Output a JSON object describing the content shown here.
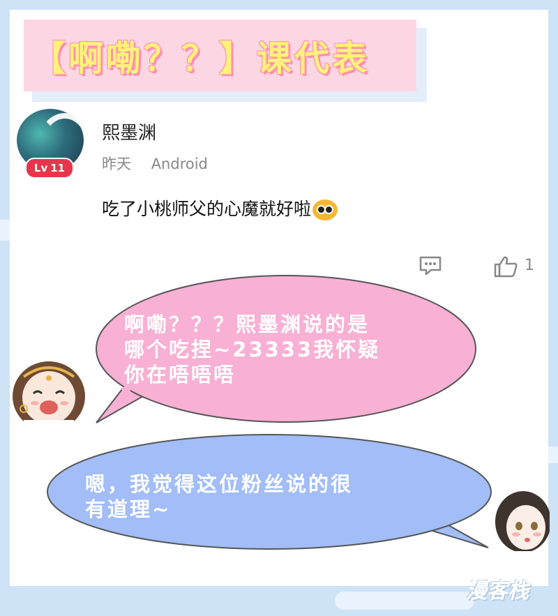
{
  "banner": {
    "title": "【啊嘞？？】课代表"
  },
  "comment": {
    "username": "熙墨渊",
    "level": "11",
    "level_prefix": "Lv",
    "time": "昨天",
    "device": "Android",
    "text": "吃了小桃师父的心魔就好啦",
    "like_count": "1"
  },
  "bubbles": {
    "pink": {
      "line1": "啊嘞？？？熙墨渊说的是",
      "line2": "哪个吃捏~23333我怀疑",
      "line3": "你在唔唔唔"
    },
    "blue": {
      "line1": "嗯，我觉得这位粉丝说的很",
      "line2": "有道理~"
    }
  },
  "watermark": "漫客栈",
  "colors": {
    "banner_bg": "#fcd6e3",
    "banner_text": "#fff27a",
    "pink_bubble": "#f8b0d4",
    "blue_bubble": "#a2bdf7",
    "level_badge": "#e8344c"
  }
}
